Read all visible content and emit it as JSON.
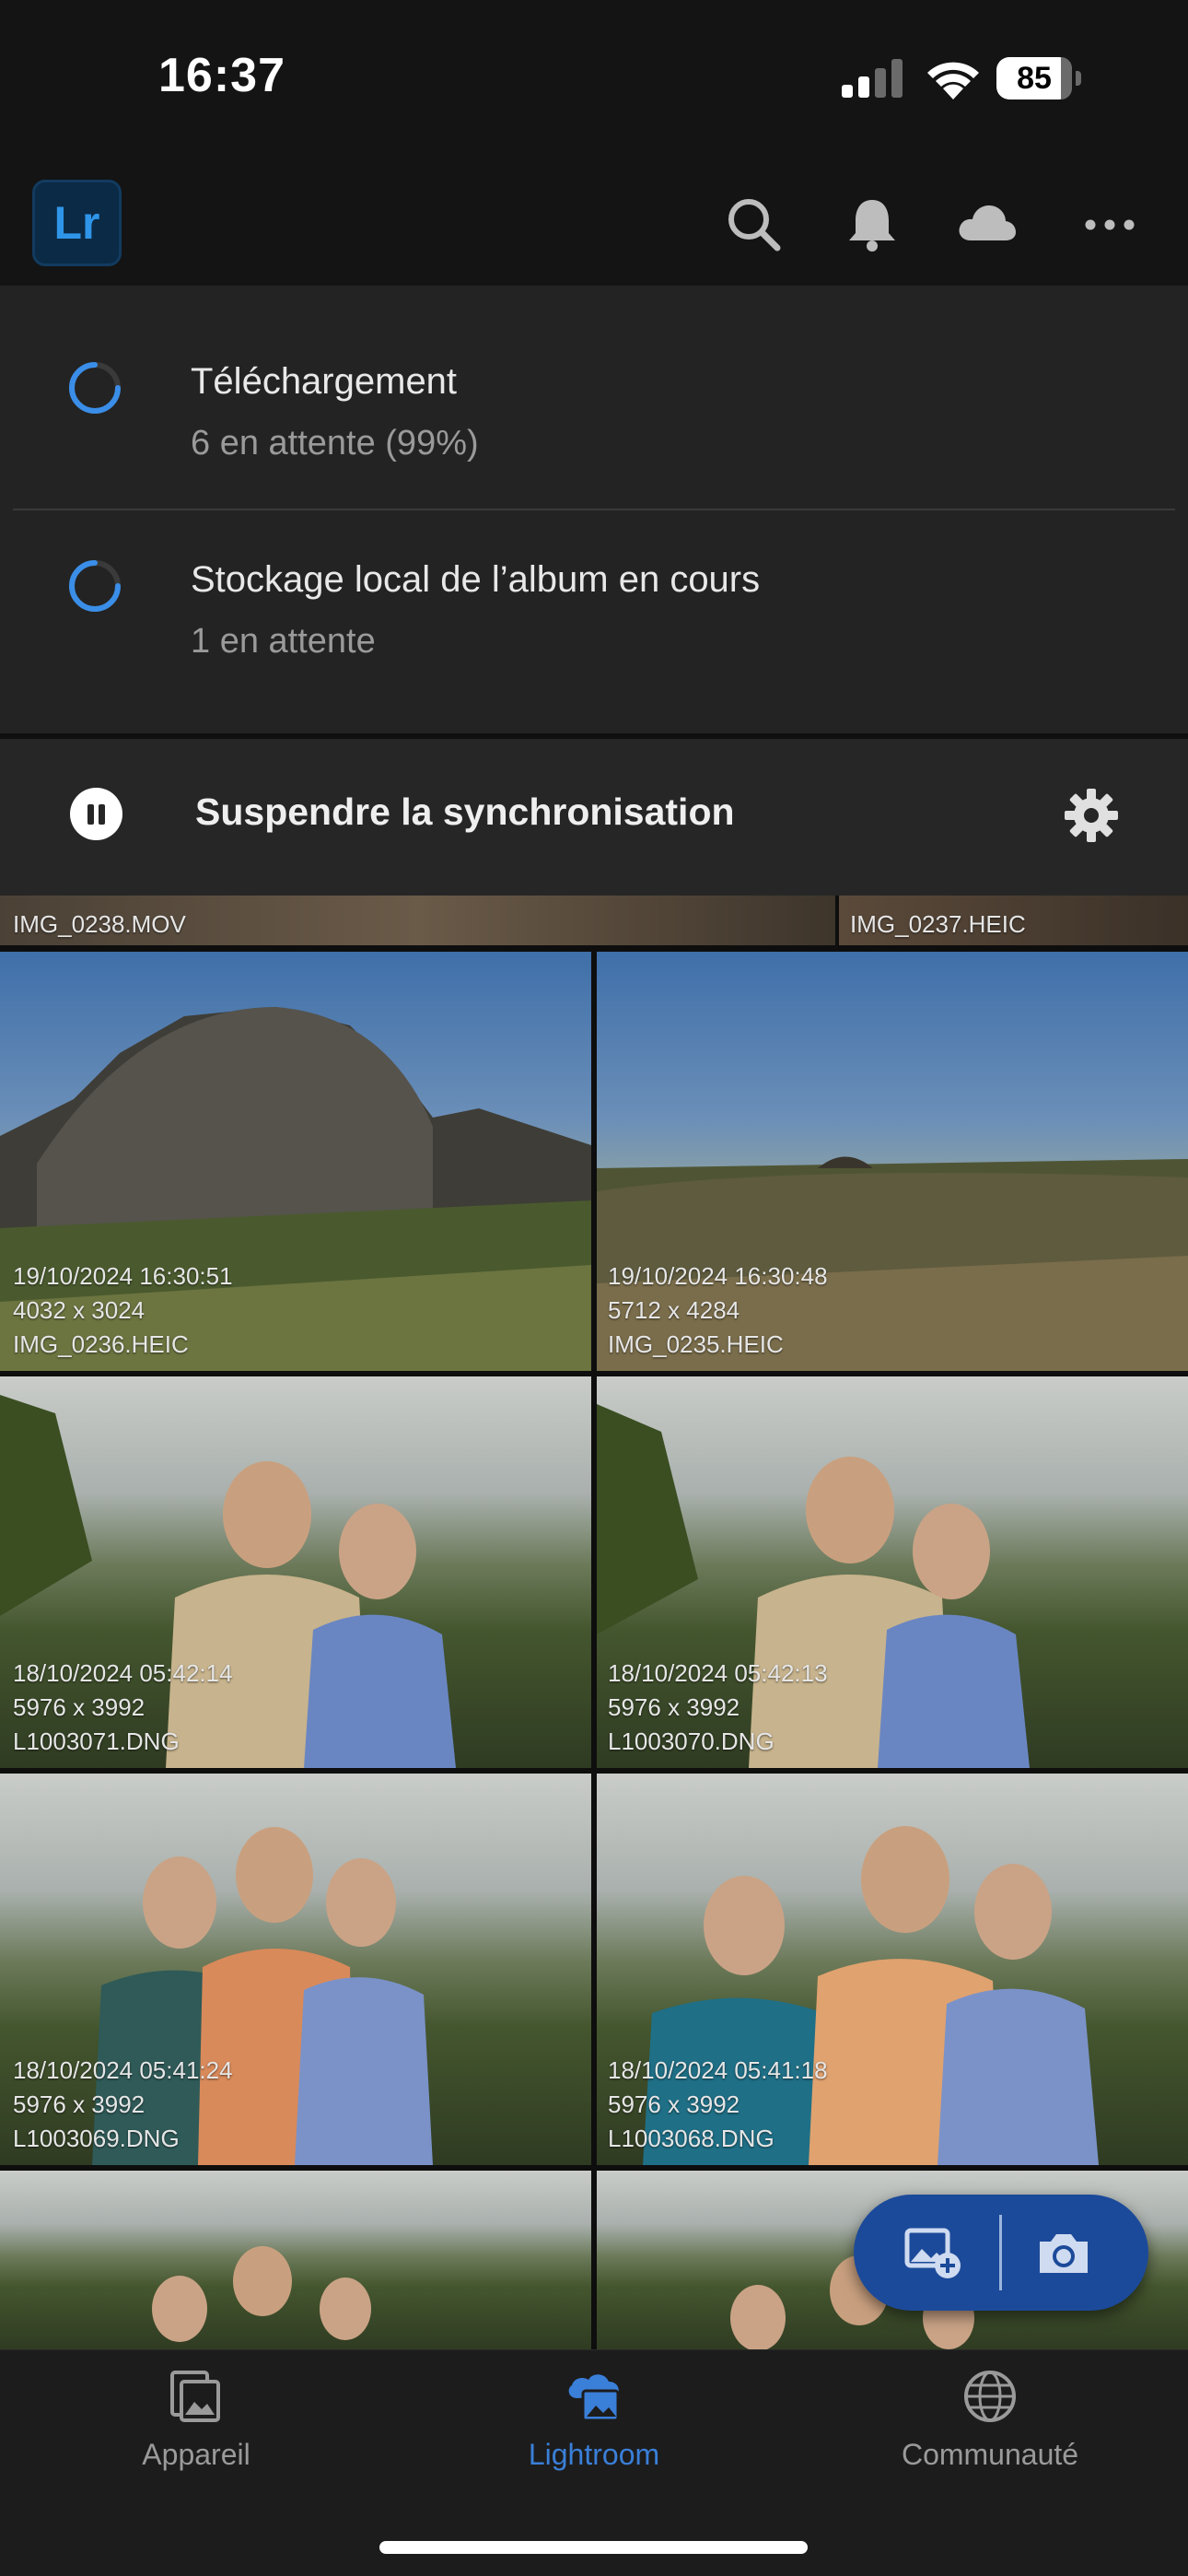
{
  "status_bar": {
    "time": "16:37",
    "battery": "85"
  },
  "header": {
    "logo": "Lr",
    "icons": [
      "search-icon",
      "bell-icon",
      "cloud-icon",
      "more-icon"
    ]
  },
  "sync": {
    "items": [
      {
        "title": "Téléchargement",
        "subtitle": "6 en attente  (99%)"
      },
      {
        "title": "Stockage local de l’album en cours",
        "subtitle": "1 en attente"
      }
    ],
    "suspend_label": "Suspendre la synchronisation"
  },
  "grid": {
    "partial_top": [
      {
        "filename": "IMG_0238.MOV"
      },
      {
        "filename": "IMG_0237.HEIC"
      }
    ],
    "tiles": [
      {
        "date": "19/10/2024 16:30:51",
        "size": "4032 x 3024",
        "filename": "IMG_0236.HEIC"
      },
      {
        "date": "19/10/2024 16:30:48",
        "size": "5712 x 4284",
        "filename": "IMG_0235.HEIC"
      },
      {
        "date": "18/10/2024 05:42:14",
        "size": "5976 x 3992",
        "filename": "L1003071.DNG"
      },
      {
        "date": "18/10/2024 05:42:13",
        "size": "5976 x 3992",
        "filename": "L1003070.DNG"
      },
      {
        "date": "18/10/2024 05:41:24",
        "size": "5976 x 3992",
        "filename": "L1003069.DNG"
      },
      {
        "date": "18/10/2024 05:41:18",
        "size": "5976 x 3992",
        "filename": "L1003068.DNG"
      }
    ]
  },
  "fab": {
    "icons": [
      "add-photo-icon",
      "camera-icon"
    ]
  },
  "nav": {
    "items": [
      {
        "label": "Appareil",
        "icon": "device-photos-icon"
      },
      {
        "label": "Lightroom",
        "icon": "lightroom-cloud-icon",
        "active": true
      },
      {
        "label": "Communauté",
        "icon": "globe-icon"
      }
    ]
  },
  "colors": {
    "accent": "#3a7fd8",
    "fab": "#1c4a9a",
    "panel": "#232323"
  }
}
